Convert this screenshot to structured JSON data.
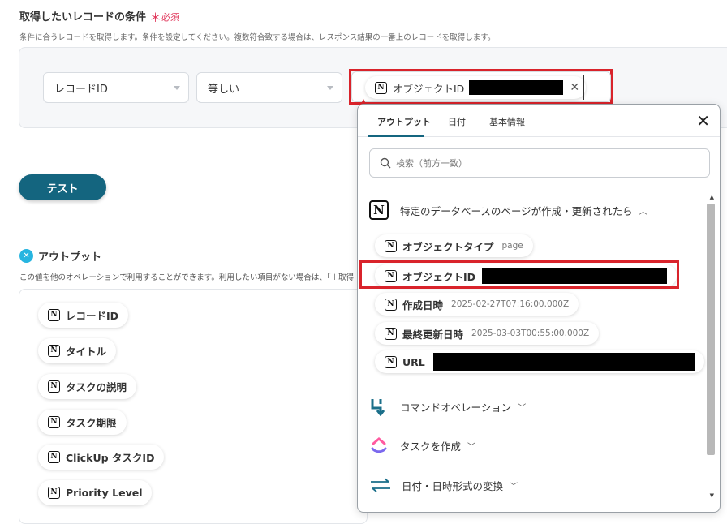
{
  "section": {
    "title": "取得したいレコードの条件",
    "required_label": "必須",
    "description": "条件に合うレコードを取得します。条件を設定してください。複数符合致する場合は、レスポンス結果の一番上のレコードを取得します。"
  },
  "condition": {
    "field_select": "レコードID",
    "operator_select": "等しい",
    "value_chip": {
      "icon": "notion-icon",
      "label": "オブジェクトID"
    }
  },
  "test_button": "テスト",
  "output": {
    "title": "アウトプット",
    "description": "この値を他のオペレーションで利用することができます。利用したい項目がない場合は、「＋取得",
    "items": [
      "レコードID",
      "タイトル",
      "タスクの説明",
      "タスク期限",
      "ClickUp タスクID",
      "Priority Level"
    ]
  },
  "popup": {
    "tabs": [
      "アウトプット",
      "日付",
      "基本情報"
    ],
    "active_tab": "アウトプット",
    "search_placeholder": "検索（前方一致）",
    "group1": {
      "title": "特定のデータベースのページが作成・更新されたら",
      "items": [
        {
          "label": "オブジェクトタイプ",
          "meta": "page"
        },
        {
          "label": "オブジェクトID",
          "meta": ""
        },
        {
          "label": "作成日時",
          "meta": "2025-02-27T07:16:00.000Z"
        },
        {
          "label": "最終更新日時",
          "meta": "2025-03-03T00:55:00.000Z"
        },
        {
          "label": "URL",
          "meta": ""
        }
      ]
    },
    "groups": [
      {
        "title": "コマンドオペレーション",
        "icon": "command-icon"
      },
      {
        "title": "タスクを作成",
        "icon": "clickup-icon"
      },
      {
        "title": "日付・日時形式の変換",
        "icon": "convert-arrows-icon"
      }
    ]
  },
  "colors": {
    "accent": "#14657f",
    "highlight_red": "#d9232b",
    "required": "#e0365a"
  }
}
